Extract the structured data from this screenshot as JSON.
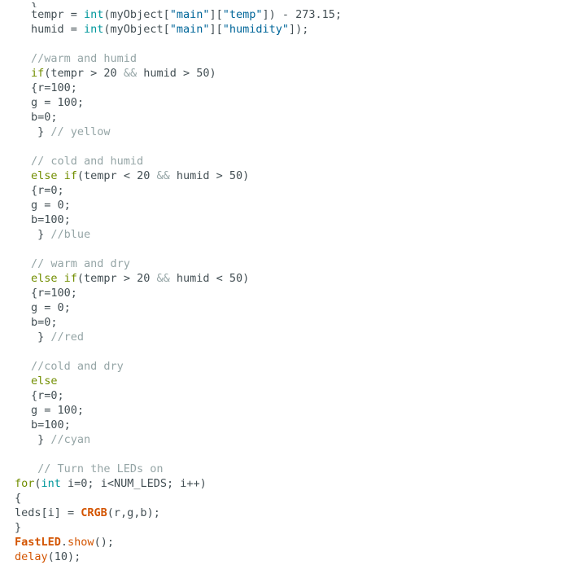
{
  "editor": {
    "name": "arduino-code-editor",
    "language": "arduino-cpp",
    "background_color": "#ffffff",
    "font_size_px": 13.5,
    "line_height_px": 18,
    "colors": {
      "plain": "#434f54",
      "keyword": "#728E00",
      "type": "#00979C",
      "string": "#006699",
      "comment": "#95A5A6",
      "function": "#D35400",
      "class": "#D35400"
    }
  },
  "lines": [
    {
      "indent": 2,
      "clipped": true,
      "tokens": [
        {
          "t": "}",
          "c": "plain"
        }
      ]
    },
    {
      "indent": 2,
      "tokens": [
        {
          "t": "tempr = ",
          "c": "plain"
        },
        {
          "t": "int",
          "c": "type"
        },
        {
          "t": "(myObject[",
          "c": "plain"
        },
        {
          "t": "\"main\"",
          "c": "string"
        },
        {
          "t": "][",
          "c": "plain"
        },
        {
          "t": "\"temp\"",
          "c": "string"
        },
        {
          "t": "]) - 273.15;",
          "c": "plain"
        }
      ]
    },
    {
      "indent": 2,
      "tokens": [
        {
          "t": "humid = ",
          "c": "plain"
        },
        {
          "t": "int",
          "c": "type"
        },
        {
          "t": "(myObject[",
          "c": "plain"
        },
        {
          "t": "\"main\"",
          "c": "string"
        },
        {
          "t": "][",
          "c": "plain"
        },
        {
          "t": "\"humidity\"",
          "c": "string"
        },
        {
          "t": "]);",
          "c": "plain"
        }
      ]
    },
    {
      "indent": 0,
      "tokens": []
    },
    {
      "indent": 2,
      "tokens": [
        {
          "t": "//warm and humid",
          "c": "comment"
        }
      ]
    },
    {
      "indent": 2,
      "tokens": [
        {
          "t": "if",
          "c": "keyword"
        },
        {
          "t": "(tempr > 20 ",
          "c": "plain"
        },
        {
          "t": "&&",
          "c": "comment"
        },
        {
          "t": " humid > 50)",
          "c": "plain"
        }
      ]
    },
    {
      "indent": 2,
      "tokens": [
        {
          "t": "{r=100;",
          "c": "plain"
        }
      ]
    },
    {
      "indent": 2,
      "tokens": [
        {
          "t": "g = 100;",
          "c": "plain"
        }
      ]
    },
    {
      "indent": 2,
      "tokens": [
        {
          "t": "b=0;",
          "c": "plain"
        }
      ]
    },
    {
      "indent": 2,
      "tokens": [
        {
          "t": " } ",
          "c": "plain"
        },
        {
          "t": "// yellow",
          "c": "comment"
        }
      ]
    },
    {
      "indent": 0,
      "tokens": []
    },
    {
      "indent": 2,
      "tokens": [
        {
          "t": "// cold and humid",
          "c": "comment"
        }
      ]
    },
    {
      "indent": 2,
      "tokens": [
        {
          "t": "else",
          "c": "keyword"
        },
        {
          "t": " ",
          "c": "plain"
        },
        {
          "t": "if",
          "c": "keyword"
        },
        {
          "t": "(tempr < 20 ",
          "c": "plain"
        },
        {
          "t": "&&",
          "c": "comment"
        },
        {
          "t": " humid > 50)",
          "c": "plain"
        }
      ]
    },
    {
      "indent": 2,
      "tokens": [
        {
          "t": "{r=0;",
          "c": "plain"
        }
      ]
    },
    {
      "indent": 2,
      "tokens": [
        {
          "t": "g = 0;",
          "c": "plain"
        }
      ]
    },
    {
      "indent": 2,
      "tokens": [
        {
          "t": "b=100;",
          "c": "plain"
        }
      ]
    },
    {
      "indent": 2,
      "tokens": [
        {
          "t": " } ",
          "c": "plain"
        },
        {
          "t": "//blue",
          "c": "comment"
        }
      ]
    },
    {
      "indent": 0,
      "tokens": []
    },
    {
      "indent": 2,
      "tokens": [
        {
          "t": "// warm and dry",
          "c": "comment"
        }
      ]
    },
    {
      "indent": 2,
      "tokens": [
        {
          "t": "else",
          "c": "keyword"
        },
        {
          "t": " ",
          "c": "plain"
        },
        {
          "t": "if",
          "c": "keyword"
        },
        {
          "t": "(tempr > 20 ",
          "c": "plain"
        },
        {
          "t": "&&",
          "c": "comment"
        },
        {
          "t": " humid < 50)",
          "c": "plain"
        }
      ]
    },
    {
      "indent": 2,
      "tokens": [
        {
          "t": "{r=100;",
          "c": "plain"
        }
      ]
    },
    {
      "indent": 2,
      "tokens": [
        {
          "t": "g = 0;",
          "c": "plain"
        }
      ]
    },
    {
      "indent": 2,
      "tokens": [
        {
          "t": "b=0;",
          "c": "plain"
        }
      ]
    },
    {
      "indent": 2,
      "tokens": [
        {
          "t": " } ",
          "c": "plain"
        },
        {
          "t": "//red",
          "c": "comment"
        }
      ]
    },
    {
      "indent": 0,
      "tokens": []
    },
    {
      "indent": 2,
      "tokens": [
        {
          "t": "//cold and dry",
          "c": "comment"
        }
      ]
    },
    {
      "indent": 2,
      "tokens": [
        {
          "t": "else",
          "c": "keyword"
        }
      ]
    },
    {
      "indent": 2,
      "tokens": [
        {
          "t": "{r=0;",
          "c": "plain"
        }
      ]
    },
    {
      "indent": 2,
      "tokens": [
        {
          "t": "g = 100;",
          "c": "plain"
        }
      ]
    },
    {
      "indent": 2,
      "tokens": [
        {
          "t": "b=100;",
          "c": "plain"
        }
      ]
    },
    {
      "indent": 2,
      "tokens": [
        {
          "t": " } ",
          "c": "plain"
        },
        {
          "t": "//cyan",
          "c": "comment"
        }
      ]
    },
    {
      "indent": 0,
      "tokens": []
    },
    {
      "indent": 2,
      "tokens": [
        {
          "t": " // Turn the LEDs on",
          "c": "comment"
        }
      ]
    },
    {
      "indent": 1,
      "tokens": [
        {
          "t": "for",
          "c": "keyword"
        },
        {
          "t": "(",
          "c": "plain"
        },
        {
          "t": "int",
          "c": "type"
        },
        {
          "t": " i=0; i<NUM_LEDS; i++)",
          "c": "plain"
        }
      ]
    },
    {
      "indent": 1,
      "tokens": [
        {
          "t": "{",
          "c": "plain"
        }
      ]
    },
    {
      "indent": 1,
      "tokens": [
        {
          "t": "leds[i] = ",
          "c": "plain"
        },
        {
          "t": "CRGB",
          "c": "class"
        },
        {
          "t": "(r,g,b);",
          "c": "plain"
        }
      ]
    },
    {
      "indent": 1,
      "tokens": [
        {
          "t": "}",
          "c": "plain"
        }
      ]
    },
    {
      "indent": 1,
      "tokens": [
        {
          "t": "FastLED",
          "c": "class"
        },
        {
          "t": ".",
          "c": "plain"
        },
        {
          "t": "show",
          "c": "func"
        },
        {
          "t": "();",
          "c": "plain"
        }
      ]
    },
    {
      "indent": 1,
      "tokens": [
        {
          "t": "delay",
          "c": "func"
        },
        {
          "t": "(10);",
          "c": "plain"
        }
      ]
    }
  ]
}
